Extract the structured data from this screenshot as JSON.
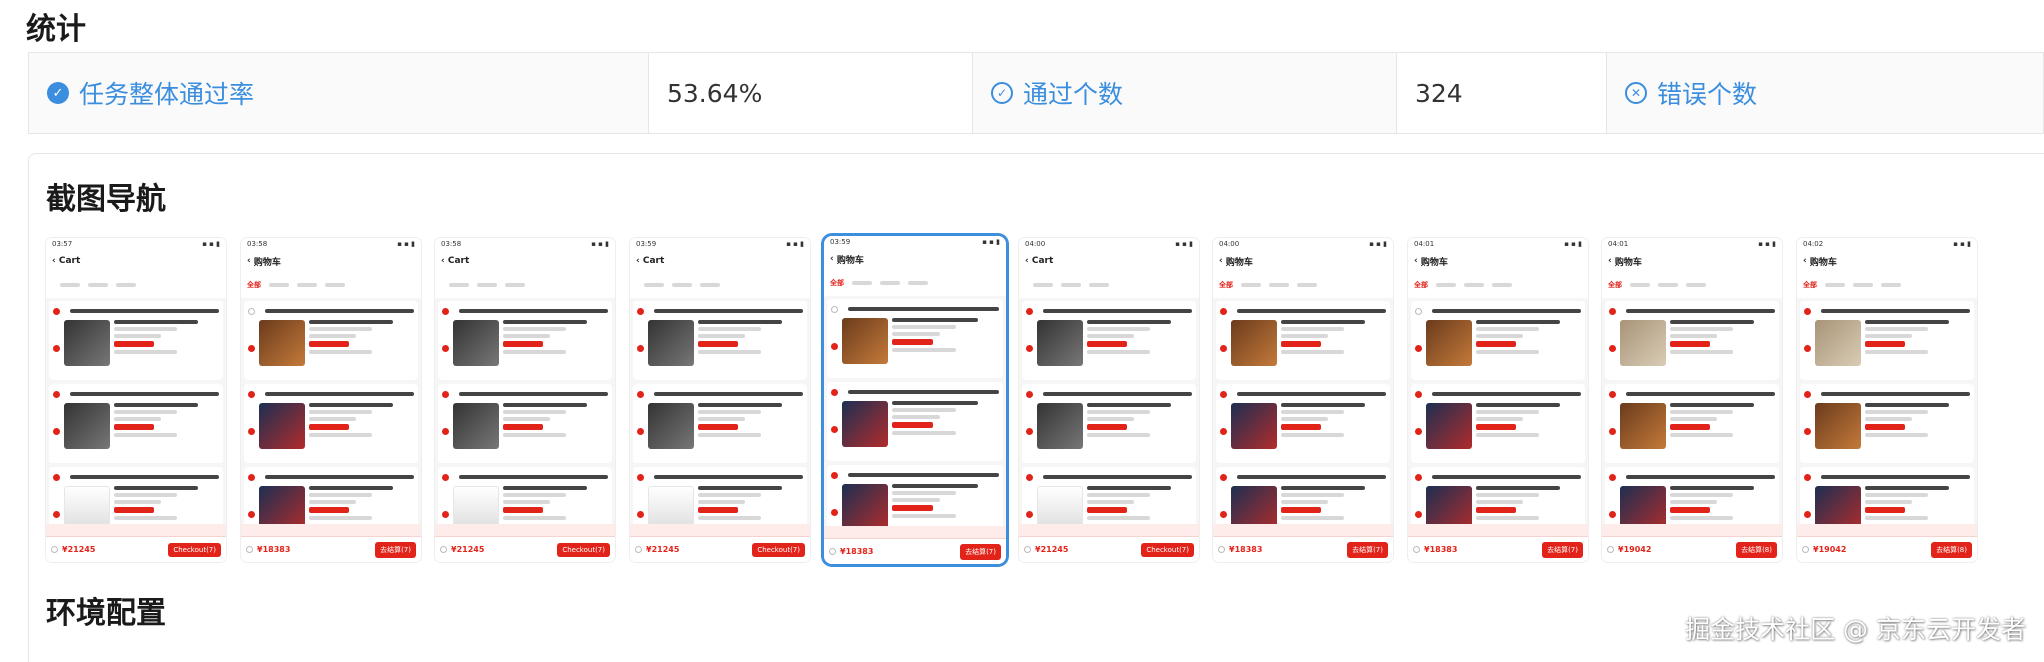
{
  "sections": {
    "stats_title": "统计",
    "nav_title": "截图导航",
    "env_title": "环境配置"
  },
  "stats": {
    "pass_rate_label": "任务整体通过率",
    "pass_rate_value": "53.64%",
    "pass_count_label": "通过个数",
    "pass_count_value": "324",
    "error_count_label": "错误个数",
    "error_count_value": ""
  },
  "colors": {
    "accent": "#3b8ede",
    "jd_red": "#e2231a"
  },
  "thumbnails": [
    {
      "time": "03:57",
      "title": "Cart",
      "tab_label": "",
      "total": "¥21245",
      "checkout": "Checkout(7)",
      "selected": false
    },
    {
      "time": "03:58",
      "title": "购物车",
      "tab_label": "全部",
      "total": "¥18383",
      "checkout": "去结算(7)",
      "selected": false
    },
    {
      "time": "03:58",
      "title": "Cart",
      "tab_label": "",
      "total": "¥21245",
      "checkout": "Checkout(7)",
      "selected": false
    },
    {
      "time": "03:59",
      "title": "Cart",
      "tab_label": "",
      "total": "¥21245",
      "checkout": "Checkout(7)",
      "selected": false
    },
    {
      "time": "03:59",
      "title": "购物车",
      "tab_label": "全部",
      "total": "¥18383",
      "checkout": "去结算(7)",
      "selected": true
    },
    {
      "time": "04:00",
      "title": "Cart",
      "tab_label": "",
      "total": "¥21245",
      "checkout": "Checkout(7)",
      "selected": false
    },
    {
      "time": "04:00",
      "title": "购物车",
      "tab_label": "全部",
      "total": "¥18383",
      "checkout": "去结算(7)",
      "selected": false
    },
    {
      "time": "04:01",
      "title": "购物车",
      "tab_label": "全部",
      "total": "¥18383",
      "checkout": "去结算(7)",
      "selected": false
    },
    {
      "time": "04:01",
      "title": "购物车",
      "tab_label": "全部",
      "total": "¥19042",
      "checkout": "去结算(8)",
      "selected": false
    },
    {
      "time": "04:02",
      "title": "购物车",
      "tab_label": "全部",
      "total": "¥19042",
      "checkout": "去结算(8)",
      "selected": false
    }
  ],
  "watermark": "掘金技术社区 @ 京东云开发者"
}
